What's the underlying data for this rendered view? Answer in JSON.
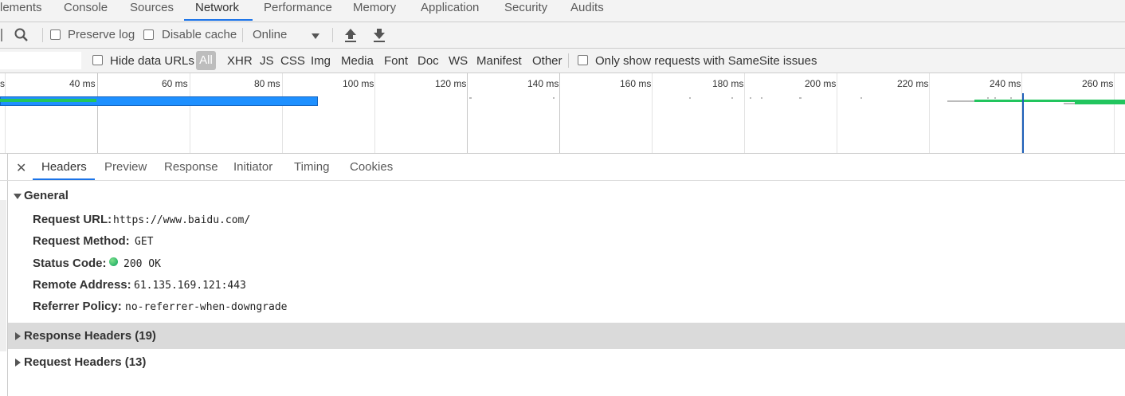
{
  "main_tabs": [
    {
      "label": "lements"
    },
    {
      "label": "Console"
    },
    {
      "label": "Sources"
    },
    {
      "label": "Network"
    },
    {
      "label": "Performance"
    },
    {
      "label": "Memory"
    },
    {
      "label": "Application"
    },
    {
      "label": "Security"
    },
    {
      "label": "Audits"
    }
  ],
  "active_tab": "Network",
  "toolbar": {
    "preserve_log": "Preserve log",
    "disable_cache": "Disable cache",
    "throttle": "Online"
  },
  "filter": {
    "hide_data_urls": "Hide data URLs",
    "types": [
      "All",
      "XHR",
      "JS",
      "CSS",
      "Img",
      "Media",
      "Font",
      "Doc",
      "WS",
      "Manifest",
      "Other"
    ],
    "samesite": "Only show requests with SameSite issues"
  },
  "overview": {
    "ticks": [
      "s",
      "40 ms",
      "60 ms",
      "80 ms",
      "100 ms",
      "120 ms",
      "140 ms",
      "160 ms",
      "180 ms",
      "200 ms",
      "220 ms",
      "240 ms",
      "260 ms"
    ]
  },
  "detail_tabs": [
    "Headers",
    "Preview",
    "Response",
    "Initiator",
    "Timing",
    "Cookies"
  ],
  "general": {
    "title": "General",
    "request_url_key": "Request URL:",
    "request_url": "https://www.baidu.com/",
    "method_key": "Request Method:",
    "method": "GET",
    "status_key": "Status Code:",
    "status": "200 OK",
    "remote_key": "Remote Address:",
    "remote": "61.135.169.121:443",
    "referrer_key": "Referrer Policy:",
    "referrer": "no-referrer-when-downgrade"
  },
  "response_headers": "Response Headers (19)",
  "request_headers": "Request Headers (13)",
  "colors": {
    "accent": "#1a73e8",
    "status_ok": "#0ba360",
    "waterfall_green": "#22c55e",
    "waterfall_blue": "#1e90ff"
  }
}
